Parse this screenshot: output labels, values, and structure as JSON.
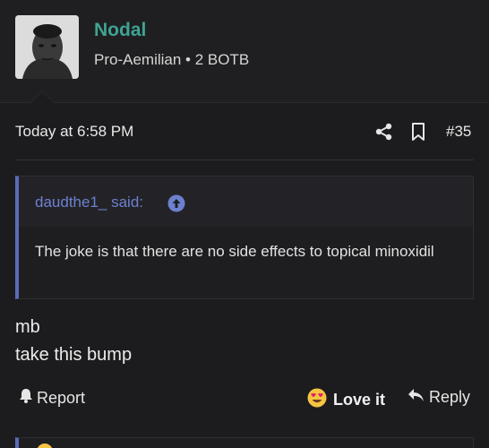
{
  "author": {
    "name": "Nodal",
    "title": "Pro-Aemilian • 2 BOTB"
  },
  "post": {
    "date": "Today at 6:58 PM",
    "number": "#35",
    "quote": {
      "author": "daudthe1_ said:",
      "text": "The joke is that there are no side effects to topical minoxidil"
    },
    "lines": [
      "mb",
      "take this bump"
    ]
  },
  "actions": {
    "report": "Report",
    "reaction": "Love it",
    "reply": "Reply"
  },
  "colors": {
    "username": "#3fa392",
    "quote_accent": "#5b6bb8",
    "quote_link": "#6d80cf",
    "background": "#1c1c1e"
  },
  "icons": [
    "share-icon",
    "bookmark-icon",
    "arrow-up-circle-icon",
    "bell-icon",
    "heart-eyes-emoji-icon",
    "reply-arrow-icon"
  ]
}
